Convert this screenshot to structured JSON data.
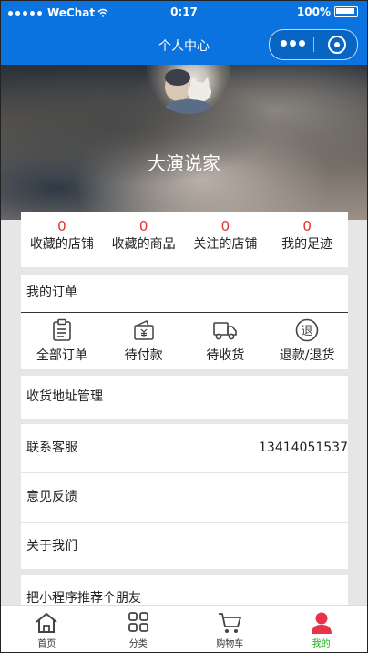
{
  "statusbar": {
    "carrier": "WeChat",
    "time": "0:17",
    "battery": "100%"
  },
  "navbar": {
    "title": "个人中心"
  },
  "profile": {
    "name": "大演说家"
  },
  "stats": [
    {
      "value": "0",
      "label": "收藏的店铺"
    },
    {
      "value": "0",
      "label": "收藏的商品"
    },
    {
      "value": "0",
      "label": "关注的店铺"
    },
    {
      "value": "0",
      "label": "我的足迹"
    }
  ],
  "orders": {
    "title": "我的订单",
    "items": [
      {
        "label": "全部订单",
        "icon": "clipboard-icon"
      },
      {
        "label": "待付款",
        "icon": "wallet-icon"
      },
      {
        "label": "待收货",
        "icon": "truck-icon"
      },
      {
        "label": "退款/退货",
        "icon": "refund-icon",
        "icon_text": "退"
      }
    ]
  },
  "menu": {
    "address": "收货地址管理",
    "service": "联系客服",
    "service_phone": "13414051537",
    "feedback": "意见反馈",
    "about": "关于我们",
    "share": "把小程序推荐个朋友"
  },
  "tabs": [
    {
      "label": "首页",
      "icon": "home-icon"
    },
    {
      "label": "分类",
      "icon": "category-icon"
    },
    {
      "label": "购物车",
      "icon": "cart-icon"
    },
    {
      "label": "我的",
      "icon": "user-icon",
      "active": true
    }
  ],
  "colors": {
    "primary": "#0a73e0",
    "stat_number": "#e0322e",
    "tab_active": "#1aad19",
    "tab_active_icon": "#e8334a"
  }
}
